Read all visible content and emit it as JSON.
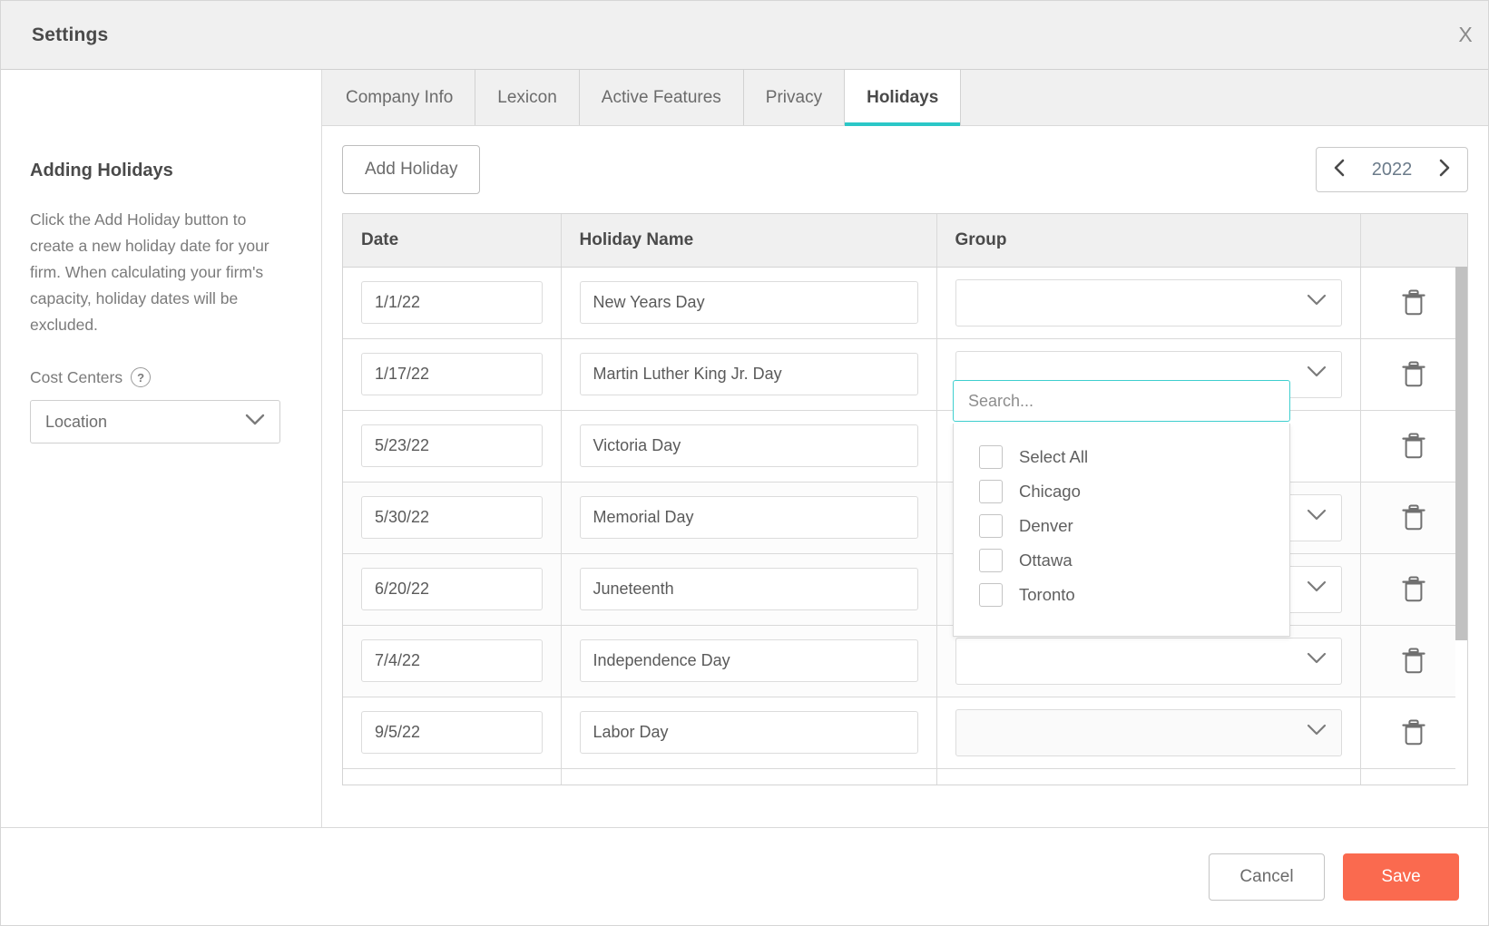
{
  "window": {
    "title": "Settings",
    "close_label": "X"
  },
  "sidebar": {
    "heading": "Adding Holidays",
    "description": "Click the Add Holiday button to create a new holiday date for your firm. When calculating your firm's capacity, holiday dates will be excluded.",
    "cost_centers_label": "Cost Centers",
    "help_glyph": "?",
    "cost_centers_value": "Location"
  },
  "tabs": [
    {
      "label": "Company Info",
      "active": false
    },
    {
      "label": "Lexicon",
      "active": false
    },
    {
      "label": "Active Features",
      "active": false
    },
    {
      "label": "Privacy",
      "active": false
    },
    {
      "label": "Holidays",
      "active": true
    }
  ],
  "toolbar": {
    "add_holiday_label": "Add Holiday",
    "year": "2022",
    "prev_year_glyph": "‹",
    "next_year_glyph": "›"
  },
  "table": {
    "headers": [
      "Date",
      "Holiday Name",
      "Group",
      ""
    ],
    "rows": [
      {
        "date": "1/1/22",
        "name": "New Years Day",
        "group": ""
      },
      {
        "date": "1/17/22",
        "name": "Martin Luther King Jr. Day",
        "group": ""
      },
      {
        "date": "5/23/22",
        "name": "Victoria Day",
        "group": ""
      },
      {
        "date": "5/30/22",
        "name": "Memorial Day",
        "group": ""
      },
      {
        "date": "6/20/22",
        "name": "Juneteenth",
        "group": ""
      },
      {
        "date": "7/4/22",
        "name": "Independence Day",
        "group": ""
      },
      {
        "date": "9/5/22",
        "name": "Labor Day",
        "group": ""
      }
    ]
  },
  "group_dropdown": {
    "open_row_index": 2,
    "search_placeholder": "Search...",
    "options": [
      {
        "label": "Select All",
        "checked": false
      },
      {
        "label": "Chicago",
        "checked": false
      },
      {
        "label": "Denver",
        "checked": false
      },
      {
        "label": "Ottawa",
        "checked": false
      },
      {
        "label": "Toronto",
        "checked": false
      }
    ]
  },
  "footer": {
    "cancel_label": "Cancel",
    "save_label": "Save"
  },
  "colors": {
    "accent_teal": "#2bc7c7",
    "save_coral": "#fa6a4f",
    "header_bg": "#f0f0f0"
  }
}
